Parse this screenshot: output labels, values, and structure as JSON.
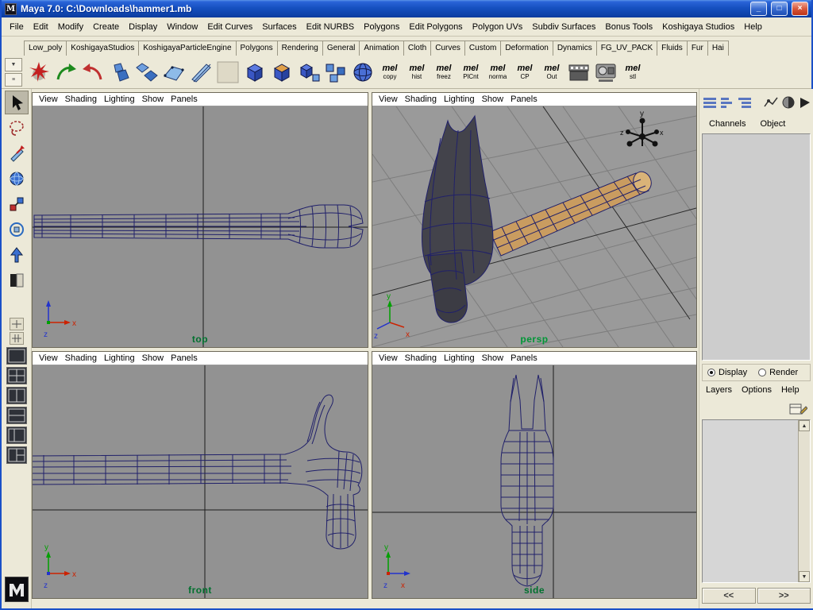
{
  "window": {
    "title": "Maya 7.0: C:\\Downloads\\hammer1.mb",
    "icon_letter": "M",
    "controls": {
      "minimize": "_",
      "maximize": "□",
      "close": "×"
    }
  },
  "menubar": {
    "items": [
      "File",
      "Edit",
      "Modify",
      "Create",
      "Display",
      "Window",
      "Edit Curves",
      "Surfaces",
      "Edit NURBS",
      "Polygons",
      "Edit Polygons",
      "Polygon UVs",
      "Subdiv Surfaces",
      "Bonus Tools",
      "Koshigaya Studios",
      "Help"
    ]
  },
  "shelf": {
    "tabs": [
      "Low_poly",
      "KoshigayaStudios",
      "KoshigayaParticleEngine",
      "Polygons",
      "Rendering",
      "General",
      "Animation",
      "Cloth",
      "Curves",
      "Custom",
      "Deformation",
      "Dynamics",
      "FG_UV_PACK",
      "Fluids",
      "Fur",
      "Hai"
    ],
    "mel_buttons": [
      {
        "t": "mel",
        "l": "copy"
      },
      {
        "t": "mel",
        "l": "hist"
      },
      {
        "t": "mel",
        "l": "freez"
      },
      {
        "t": "mel",
        "l": "PlCnt"
      },
      {
        "t": "mel",
        "l": "norma"
      },
      {
        "t": "mel",
        "l": "CP"
      },
      {
        "t": "mel",
        "l": "Out"
      },
      {
        "t": "mel",
        "l": "stl"
      }
    ]
  },
  "viewport_menu": [
    "View",
    "Shading",
    "Lighting",
    "Show",
    "Panels"
  ],
  "viewports": {
    "top": "top",
    "persp": "persp",
    "front": "front",
    "side": "side"
  },
  "axes": {
    "x": "x",
    "y": "y",
    "z": "z"
  },
  "right_panel": {
    "tabs": {
      "channels": "Channels",
      "object": "Object"
    },
    "display_radio": "Display",
    "render_radio": "Render",
    "layer_menu": [
      "Layers",
      "Options",
      "Help"
    ],
    "nav": {
      "back": "<<",
      "forward": ">>"
    }
  },
  "colors": {
    "titlebar_blue": "#1650c0",
    "chrome_beige": "#ece9d8",
    "viewport_gray": "#929292",
    "wireframe_navy": "#20206a",
    "handle_tan": "#c99c60",
    "head_gray": "#43434b",
    "view_label_green": "#00702e"
  }
}
